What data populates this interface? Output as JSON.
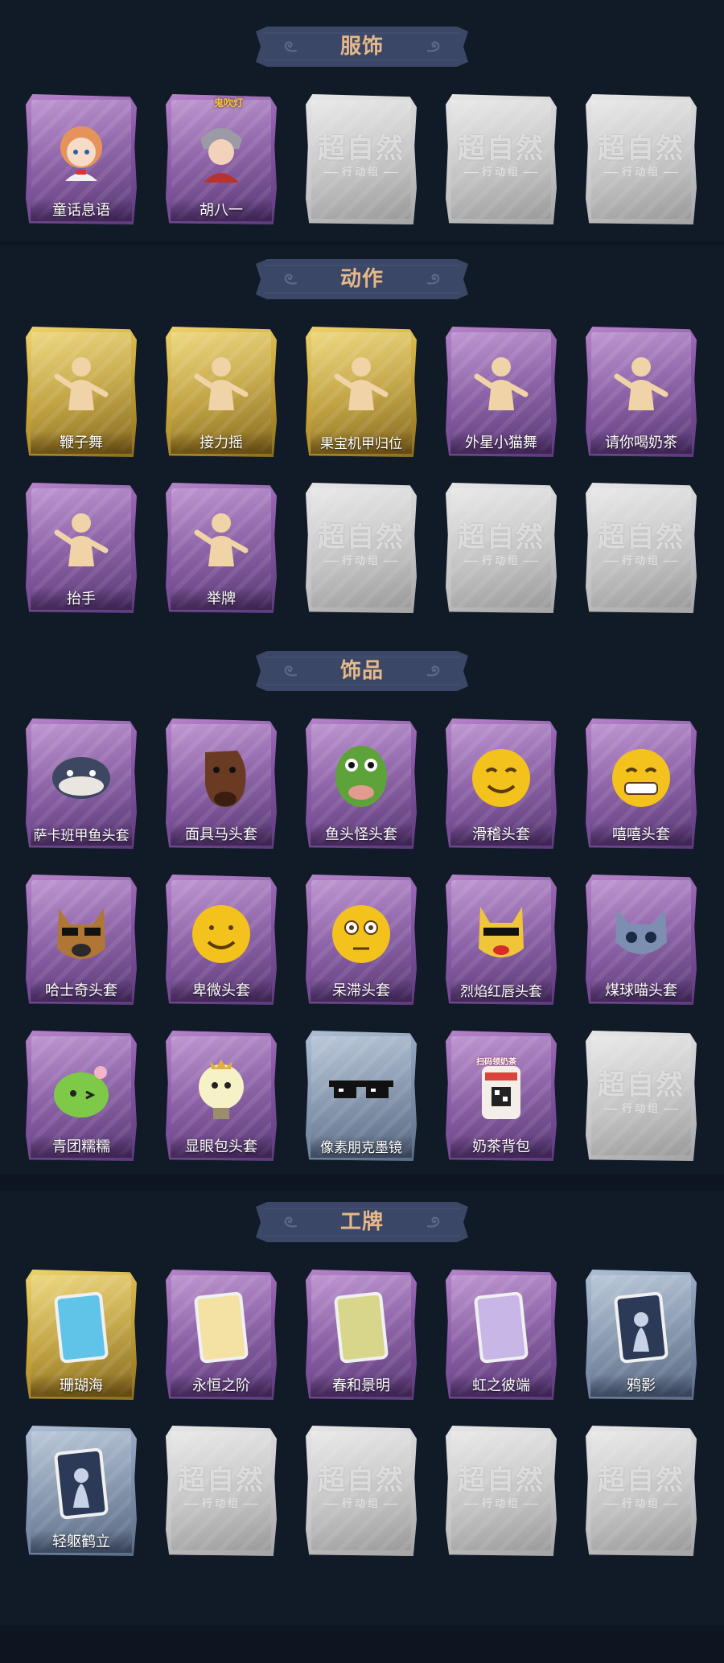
{
  "colors": {
    "background": "#0d1520",
    "banner_bg": "#3a4766",
    "title_text": "#e7b98a",
    "rarity_purple": "#8a5aa8",
    "rarity_gold": "#c8a63a",
    "rarity_blue": "#8396b0",
    "empty_slot": "#c9c9c9"
  },
  "placeholder": {
    "logo_text": "超自然",
    "sub_text": "行动组"
  },
  "sections": [
    {
      "title": "服饰",
      "items": [
        {
          "name": "童话息语",
          "rarity": "purple",
          "icon": "fairy-girl-avatar-icon"
        },
        {
          "name": "胡八一",
          "rarity": "purple",
          "icon": "hu-bayi-avatar-icon",
          "badge": "鬼吹灯"
        },
        {
          "name": "",
          "rarity": "empty",
          "icon": "empty-slot-icon"
        },
        {
          "name": "",
          "rarity": "empty",
          "icon": "empty-slot-icon"
        },
        {
          "name": "",
          "rarity": "empty",
          "icon": "empty-slot-icon"
        }
      ]
    },
    {
      "title": "动作",
      "items": [
        {
          "name": "鞭子舞",
          "rarity": "gold",
          "icon": "whip-dance-pose-icon"
        },
        {
          "name": "接力摇",
          "rarity": "gold",
          "icon": "relay-shake-pose-icon"
        },
        {
          "name": "果宝机甲归位",
          "rarity": "gold",
          "icon": "mecha-pose-icon"
        },
        {
          "name": "外星小猫舞",
          "rarity": "purple",
          "icon": "alien-cat-dance-pose-icon"
        },
        {
          "name": "请你喝奶茶",
          "rarity": "purple",
          "icon": "milk-tea-pose-icon"
        },
        {
          "name": "抬手",
          "rarity": "purple",
          "icon": "raise-hand-pose-icon"
        },
        {
          "name": "举牌",
          "rarity": "purple",
          "icon": "hold-sign-pose-icon"
        },
        {
          "name": "",
          "rarity": "empty",
          "icon": "empty-slot-icon"
        },
        {
          "name": "",
          "rarity": "empty",
          "icon": "empty-slot-icon"
        },
        {
          "name": "",
          "rarity": "empty",
          "icon": "empty-slot-icon"
        }
      ]
    },
    {
      "title": "饰品",
      "items": [
        {
          "name": "萨卡班甲鱼头套",
          "rarity": "purple",
          "icon": "fish-mask-icon"
        },
        {
          "name": "面具马头套",
          "rarity": "purple",
          "icon": "horse-mask-icon"
        },
        {
          "name": "鱼头怪头套",
          "rarity": "purple",
          "icon": "fish-monster-mask-icon"
        },
        {
          "name": "滑稽头套",
          "rarity": "purple",
          "icon": "funny-face-mask-icon"
        },
        {
          "name": "嘻嘻头套",
          "rarity": "purple",
          "icon": "grin-face-mask-icon"
        },
        {
          "name": "哈士奇头套",
          "rarity": "purple",
          "icon": "husky-mask-icon"
        },
        {
          "name": "卑微头套",
          "rarity": "purple",
          "icon": "humble-face-mask-icon"
        },
        {
          "name": "呆滞头套",
          "rarity": "purple",
          "icon": "dazed-face-mask-icon"
        },
        {
          "name": "烈焰红唇头套",
          "rarity": "purple",
          "icon": "red-lips-mask-icon"
        },
        {
          "name": "煤球喵头套",
          "rarity": "purple",
          "icon": "cat-mask-icon"
        },
        {
          "name": "青团糯糯",
          "rarity": "purple",
          "icon": "green-dumpling-icon"
        },
        {
          "name": "显眼包头套",
          "rarity": "purple",
          "icon": "bulb-mask-icon"
        },
        {
          "name": "像素朋克墨镜",
          "rarity": "blue",
          "icon": "pixel-sunglasses-icon"
        },
        {
          "name": "奶茶背包",
          "rarity": "purple",
          "icon": "milk-tea-backpack-icon",
          "badge": "扫码领奶茶"
        },
        {
          "name": "",
          "rarity": "empty",
          "icon": "empty-slot-icon"
        }
      ]
    },
    {
      "title": "工牌",
      "items": [
        {
          "name": "珊瑚海",
          "rarity": "gold",
          "icon": "coral-sea-badge-icon"
        },
        {
          "name": "永恒之阶",
          "rarity": "purple",
          "icon": "eternal-steps-badge-icon"
        },
        {
          "name": "春和景明",
          "rarity": "purple",
          "icon": "spring-badge-icon"
        },
        {
          "name": "虹之彼端",
          "rarity": "purple",
          "icon": "rainbow-badge-icon"
        },
        {
          "name": "鸦影",
          "rarity": "blue",
          "icon": "crow-shadow-badge-icon"
        },
        {
          "name": "轻躯鹤立",
          "rarity": "blue",
          "icon": "crane-badge-icon"
        },
        {
          "name": "",
          "rarity": "empty",
          "icon": "empty-slot-icon"
        },
        {
          "name": "",
          "rarity": "empty",
          "icon": "empty-slot-icon"
        },
        {
          "name": "",
          "rarity": "empty",
          "icon": "empty-slot-icon"
        },
        {
          "name": "",
          "rarity": "empty",
          "icon": "empty-slot-icon"
        }
      ]
    }
  ]
}
